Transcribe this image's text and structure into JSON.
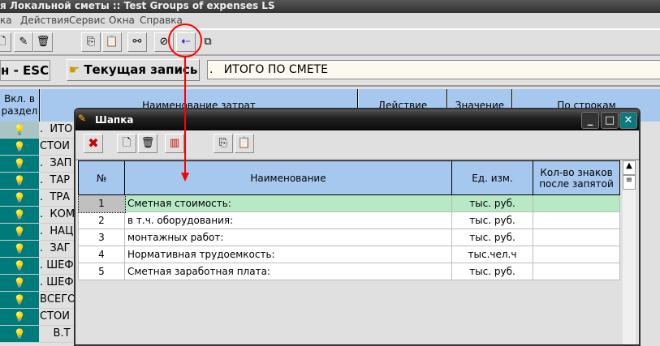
{
  "window": {
    "title": "я Локальной сметы :: Test Groups of expenses LS"
  },
  "menu": [
    "ка",
    "Действия",
    "Сервис",
    "Окна",
    "Справка"
  ],
  "nav": {
    "esc_label": "н - ESC",
    "current_record_label": "Текущая запись",
    "current_record_value": ".   ИТОГО ПО СМЕТЕ"
  },
  "grid": {
    "headers": [
      "Вкл. в раздел",
      "Наименование затрат",
      "Действие",
      "Значение",
      "По строкам"
    ],
    "rows": [
      ".  ИТО",
      "СТОИ",
      ".  ЗАП",
      ".  ТАР",
      ".  ТРА",
      ".  КОМ",
      ".  НАЦ",
      ".  ЗАГ",
      ". ШЕФ",
      ". ШЕФ",
      "ВСЕГО",
      "СТОИ",
      "    В.Т"
    ]
  },
  "dialog": {
    "title": "Шапка",
    "headers": [
      "№",
      "Наименование",
      "Ед. изм.",
      "Кол-во знаков после запятой"
    ],
    "rows": [
      {
        "n": "1",
        "name": "Сметная стоимость:",
        "unit": "тыс. руб.",
        "dec": ""
      },
      {
        "n": "2",
        "name": "в т.ч. оборудования:",
        "unit": "тыс. руб.",
        "dec": ""
      },
      {
        "n": "3",
        "name": "монтажных работ:",
        "unit": "тыс. руб.",
        "dec": ""
      },
      {
        "n": "4",
        "name": "Нормативная трудоемкость:",
        "unit": "тыс.чел.ч",
        "dec": ""
      },
      {
        "n": "5",
        "name": "Сметная заработная плата:",
        "unit": "тыс. руб.",
        "dec": ""
      }
    ]
  },
  "colors": {
    "header": "#a6c8ee",
    "selected_row": "#b9e8c4",
    "teal": "#007b7b",
    "annotation": "#ff0000"
  }
}
